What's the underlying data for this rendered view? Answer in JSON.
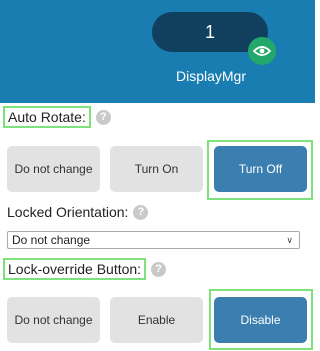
{
  "header": {
    "count": "1",
    "app_name": "DisplayMgr",
    "eye_icon": "eye-icon",
    "bg_color": "#1a7db2"
  },
  "auto_rotate": {
    "label": "Auto Rotate:",
    "help": "?",
    "options": [
      "Do not change",
      "Turn On",
      "Turn Off"
    ],
    "selected": "Turn Off"
  },
  "locked_orientation": {
    "label": "Locked Orientation:",
    "help": "?",
    "value": "Do not change"
  },
  "lock_override": {
    "label": "Lock-override Button:",
    "help": "?",
    "options": [
      "Do not change",
      "Enable",
      "Disable"
    ],
    "selected": "Disable"
  },
  "colors": {
    "active_button": "#3b7eb0",
    "highlight": "#7ee27a"
  }
}
